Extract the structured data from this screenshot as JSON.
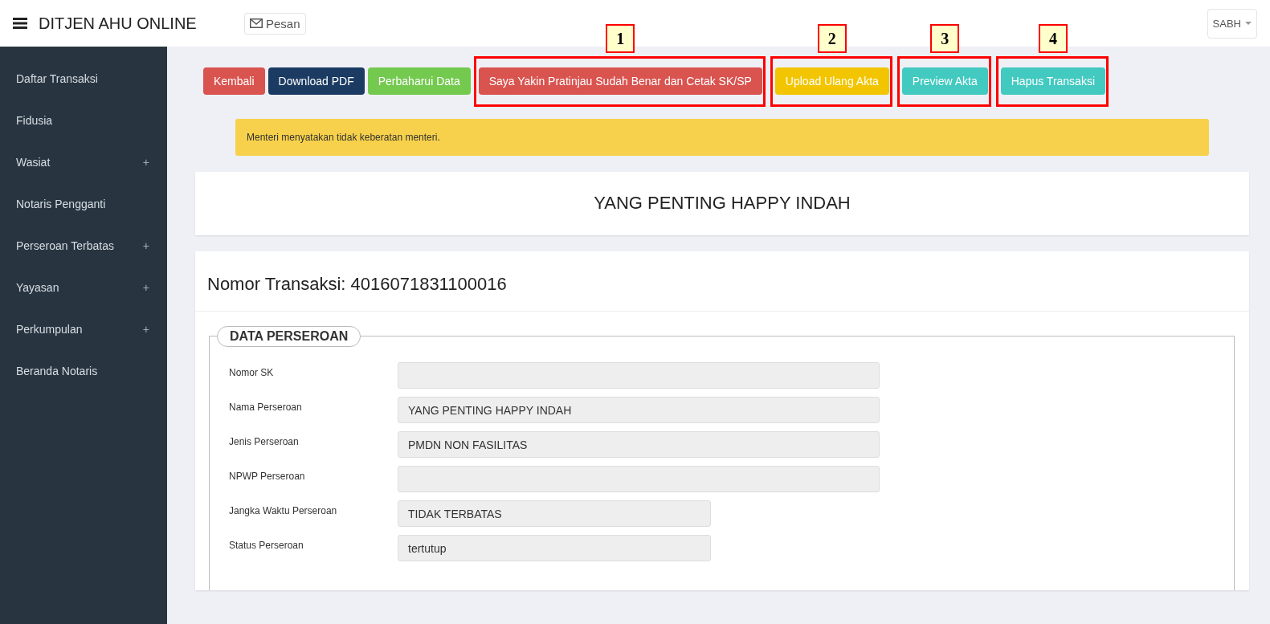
{
  "header": {
    "title": "DITJEN AHU ONLINE",
    "messages_button": "Pesan",
    "user_menu": "SABH"
  },
  "sidebar": {
    "items": [
      {
        "label": "Daftar Transaksi"
      },
      {
        "label": "Fidusia"
      },
      {
        "label": "Wasiat",
        "toggle": "+"
      },
      {
        "label": "Notaris Pengganti"
      },
      {
        "label": "Perseroan Terbatas",
        "toggle": "+"
      },
      {
        "label": "Yayasan",
        "toggle": "+"
      },
      {
        "label": "Perkumpulan",
        "toggle": "+"
      },
      {
        "label": "Beranda Notaris"
      }
    ]
  },
  "actions": [
    {
      "label": "Kembali",
      "color": "#d9534f"
    },
    {
      "label": "Download PDF",
      "color": "#1b3b63"
    },
    {
      "label": "Perbaharui Data",
      "color": "#74c94f"
    },
    {
      "label": "Saya Yakin Pratinjau Sudah Benar dan Cetak SK/SP",
      "color": "#d9534f",
      "callout": "1"
    },
    {
      "label": "Upload Ulang Akta",
      "color": "#f2c500",
      "callout": "2"
    },
    {
      "label": "Preview Akta",
      "color": "#42c9c0",
      "callout": "3"
    },
    {
      "label": "Hapus Transaksi",
      "color": "#42c9c0",
      "callout": "4"
    }
  ],
  "alert": "Menteri menyatakan tidak keberatan menteri.",
  "company_title": "YANG PENTING HAPPY INDAH",
  "transaction": {
    "heading": "Nomor Transaksi: 4016071831100016",
    "legend": "DATA PERSEROAN",
    "fields": [
      {
        "label": "Nomor SK",
        "kind": "wide"
      },
      {
        "label": "Nama Perseroan",
        "value": "YANG PENTING HAPPY INDAH",
        "kind": "wide"
      },
      {
        "label": "Jenis Perseroan",
        "value": "PMDN NON FASILITAS",
        "kind": "wide"
      },
      {
        "label": "NPWP Perseroan",
        "kind": "wide"
      },
      {
        "label": "Jangka Waktu Perseroan",
        "value": "TIDAK TERBATAS",
        "kind": "medium"
      },
      {
        "label": "Status Perseroan",
        "value": "tertutup",
        "kind": "medium"
      }
    ]
  }
}
